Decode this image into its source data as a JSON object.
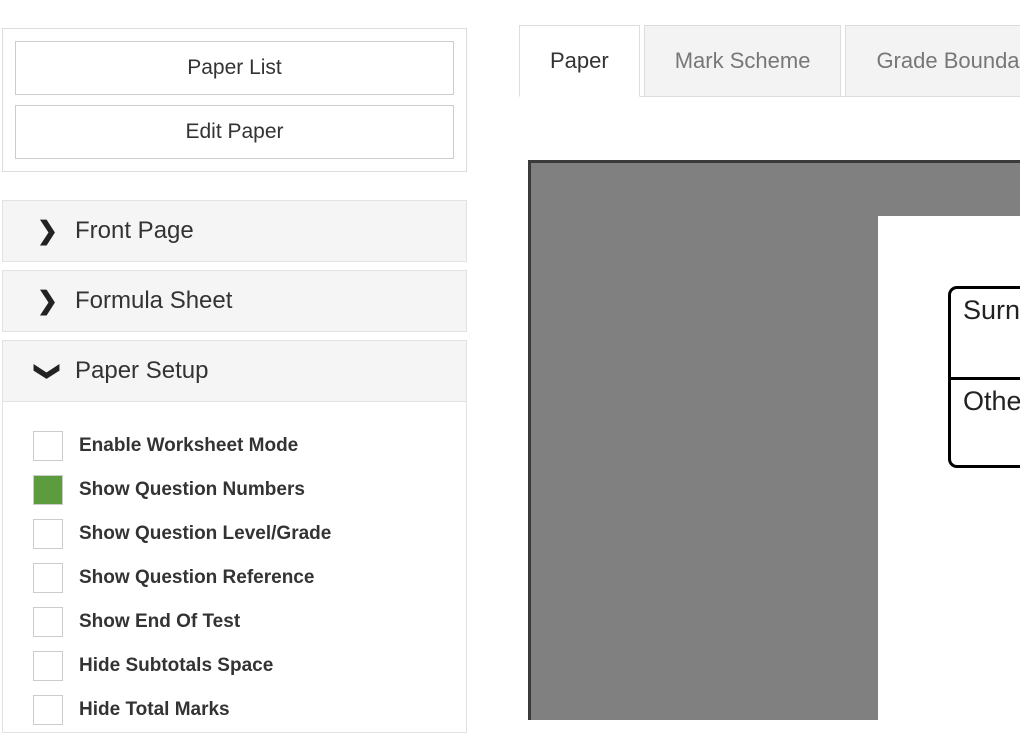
{
  "sidebar": {
    "nav_buttons": [
      {
        "label": "Paper List",
        "name": "paper-list-button"
      },
      {
        "label": "Edit Paper",
        "name": "edit-paper-button"
      }
    ],
    "accordion": [
      {
        "label": "Front Page",
        "expanded": false,
        "icon": "chevron-right-icon"
      },
      {
        "label": "Formula Sheet",
        "expanded": false,
        "icon": "chevron-right-icon"
      },
      {
        "label": "Paper Setup",
        "expanded": true,
        "icon": "chevron-down-icon"
      }
    ],
    "paper_setup_options": [
      {
        "label": "Enable Worksheet Mode",
        "checked": false
      },
      {
        "label": "Show Question Numbers",
        "checked": true
      },
      {
        "label": "Show Question Level/Grade",
        "checked": false
      },
      {
        "label": "Show Question Reference",
        "checked": false
      },
      {
        "label": "Show End Of Test",
        "checked": false
      },
      {
        "label": "Hide Subtotals Space",
        "checked": false
      },
      {
        "label": "Hide Total Marks",
        "checked": false
      }
    ]
  },
  "main": {
    "tabs": [
      {
        "label": "Paper",
        "active": true
      },
      {
        "label": "Mark Scheme",
        "active": false
      },
      {
        "label": "Grade Boundaries",
        "active": false
      }
    ],
    "preview": {
      "name_box": [
        {
          "label": "Surname"
        },
        {
          "label": "Other names"
        }
      ]
    }
  },
  "colors": {
    "checkbox_checked": "#5d9c3e",
    "preview_backdrop": "#808080",
    "accordion_header": "#f5f5f5",
    "tab_inactive_text": "#777777"
  }
}
